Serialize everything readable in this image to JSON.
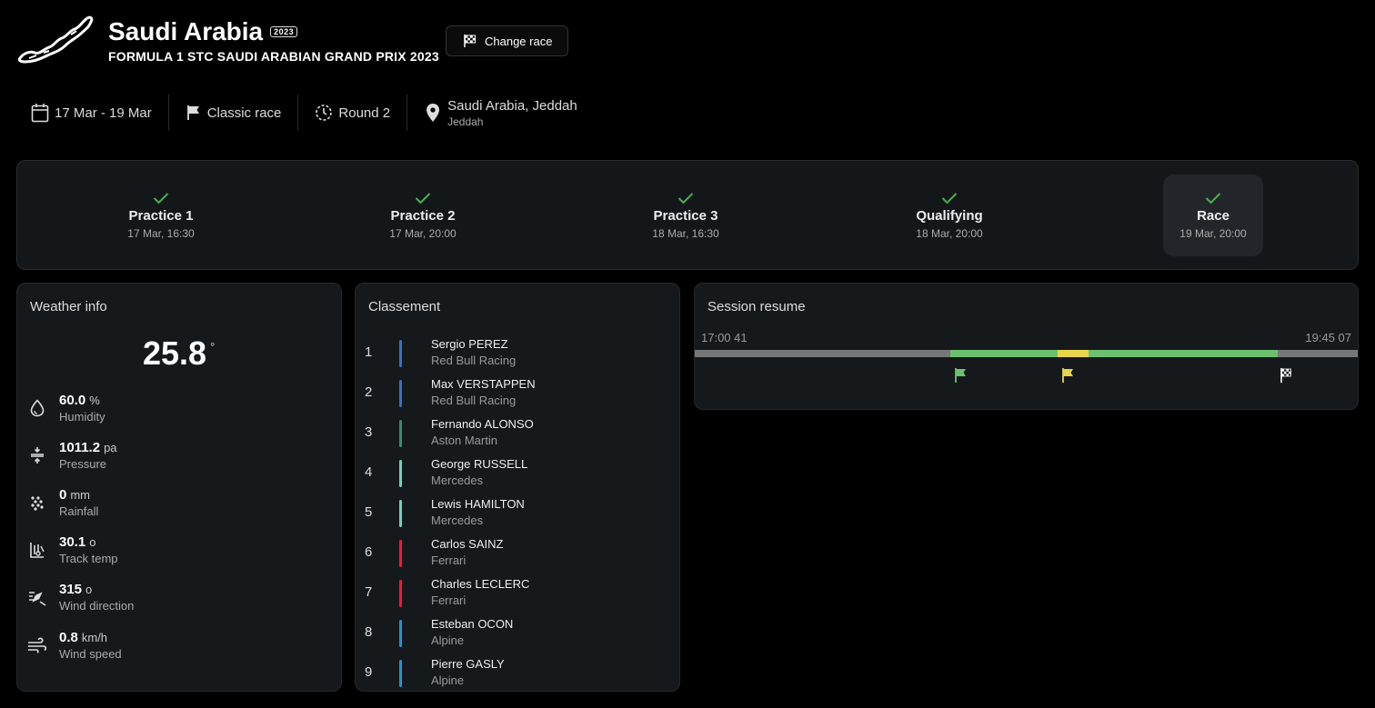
{
  "header": {
    "title": "Saudi Arabia",
    "year_badge": "2023",
    "subtitle": "FORMULA 1 STC SAUDI ARABIAN GRAND PRIX 2023",
    "change_race_label": "Change race"
  },
  "info": {
    "dates": "17 Mar - 19 Mar",
    "race_type": "Classic race",
    "round": "Round 2",
    "location": "Saudi Arabia, Jeddah",
    "city": "Jeddah"
  },
  "sessions": [
    {
      "name": "Practice 1",
      "date": "17 Mar, 16:30",
      "completed": true
    },
    {
      "name": "Practice 2",
      "date": "17 Mar, 20:00",
      "completed": true
    },
    {
      "name": "Practice 3",
      "date": "18 Mar, 16:30",
      "completed": true
    },
    {
      "name": "Qualifying",
      "date": "18 Mar, 20:00",
      "completed": true
    },
    {
      "name": "Race",
      "date": "19 Mar, 20:00",
      "completed": true,
      "active": true
    }
  ],
  "weather": {
    "title": "Weather info",
    "temperature": "25.8",
    "temperature_unit": "°",
    "metrics": [
      {
        "value": "60.0",
        "unit": "%",
        "label": "Humidity",
        "icon": "droplet-icon"
      },
      {
        "value": "1011.2",
        "unit": "pa",
        "label": "Pressure",
        "icon": "pressure-icon"
      },
      {
        "value": "0",
        "unit": "mm",
        "label": "Rainfall",
        "icon": "rain-icon"
      },
      {
        "value": "30.1",
        "unit": "o",
        "label": "Track temp",
        "icon": "track-temp-icon"
      },
      {
        "value": "315",
        "unit": "o",
        "label": "Wind direction",
        "icon": "wind-direction-icon"
      },
      {
        "value": "0.8",
        "unit": "km/h",
        "label": "Wind speed",
        "icon": "wind-icon"
      }
    ]
  },
  "standings": {
    "title": "Classement",
    "drivers": [
      {
        "pos": "1",
        "name": "Sergio PEREZ",
        "team": "Red Bull Racing",
        "color": "#3671c6"
      },
      {
        "pos": "2",
        "name": "Max VERSTAPPEN",
        "team": "Red Bull Racing",
        "color": "#3671c6"
      },
      {
        "pos": "3",
        "name": "Fernando ALONSO",
        "team": "Aston Martin",
        "color": "#358c75"
      },
      {
        "pos": "4",
        "name": "George RUSSELL",
        "team": "Mercedes",
        "color": "#6cd3bf"
      },
      {
        "pos": "5",
        "name": "Lewis HAMILTON",
        "team": "Mercedes",
        "color": "#6cd3bf"
      },
      {
        "pos": "6",
        "name": "Carlos SAINZ",
        "team": "Ferrari",
        "color": "#f91536"
      },
      {
        "pos": "7",
        "name": "Charles LECLERC",
        "team": "Ferrari",
        "color": "#f91536"
      },
      {
        "pos": "8",
        "name": "Esteban OCON",
        "team": "Alpine",
        "color": "#2293d1"
      },
      {
        "pos": "9",
        "name": "Pierre GASLY",
        "team": "Alpine",
        "color": "#2293d1"
      }
    ]
  },
  "session_resume": {
    "title": "Session resume",
    "start_time": "17:00 41",
    "end_time": "19:45 07",
    "segments": [
      {
        "status": "inactive",
        "from": 0.0,
        "to": 0.385,
        "color": "#777777"
      },
      {
        "status": "green",
        "from": 0.385,
        "to": 0.547,
        "color": "#6cc070"
      },
      {
        "status": "yellow",
        "from": 0.547,
        "to": 0.594,
        "color": "#e8d44d"
      },
      {
        "status": "green",
        "from": 0.594,
        "to": 0.879,
        "color": "#6cc070"
      },
      {
        "status": "finished",
        "from": 0.879,
        "to": 1.0,
        "color": "#777777"
      }
    ],
    "flags": [
      {
        "type": "green",
        "at": 0.4,
        "color": "#6cc070"
      },
      {
        "type": "yellow",
        "at": 0.562,
        "color": "#e8d44d"
      },
      {
        "type": "chequered",
        "at": 0.892,
        "color": "#ffffff"
      }
    ]
  },
  "colors": {
    "check": "#4caf50",
    "panel_bg": "#16191c"
  }
}
